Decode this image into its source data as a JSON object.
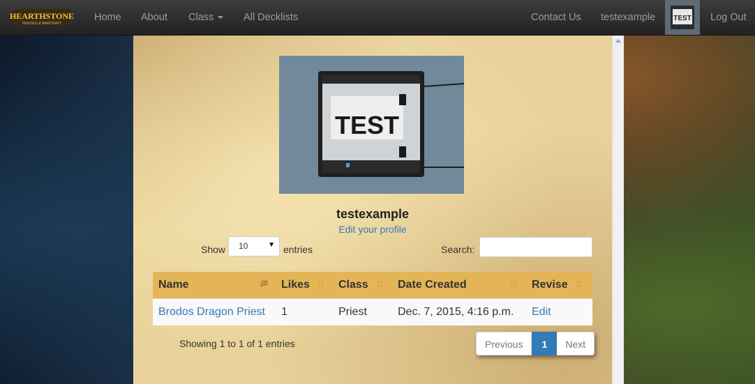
{
  "nav": {
    "brand_name": "HEARTHSTONE",
    "brand_sub": "HEROES of WARCRAFT",
    "home": "Home",
    "about": "About",
    "class": "Class",
    "decklists": "All Decklists",
    "contact": "Contact Us",
    "user": "testexample",
    "logout": "Log Out",
    "avatar_text": "TEST"
  },
  "profile": {
    "image_text": "TEST",
    "username": "testexample",
    "edit_link": "Edit your profile"
  },
  "table_controls": {
    "show_label": "Show",
    "entries_selected": "10",
    "entries_label": "entries",
    "search_label": "Search:",
    "search_value": ""
  },
  "table": {
    "columns": [
      "Name",
      "Likes",
      "Class",
      "Date Created",
      "Revise"
    ],
    "rows": [
      {
        "name": "Brodos Dragon Priest",
        "likes": "1",
        "class": "Priest",
        "date": "Dec. 7, 2015, 4:16 p.m.",
        "revise": "Edit"
      }
    ]
  },
  "footer": {
    "info": "Showing 1 to 1 of 1 entries",
    "previous": "Previous",
    "page": "1",
    "next": "Next"
  },
  "colors": {
    "header_bg": "#e4b557",
    "link": "#337ab7",
    "navbar": "#222222",
    "parchment": "#e9d39b"
  }
}
